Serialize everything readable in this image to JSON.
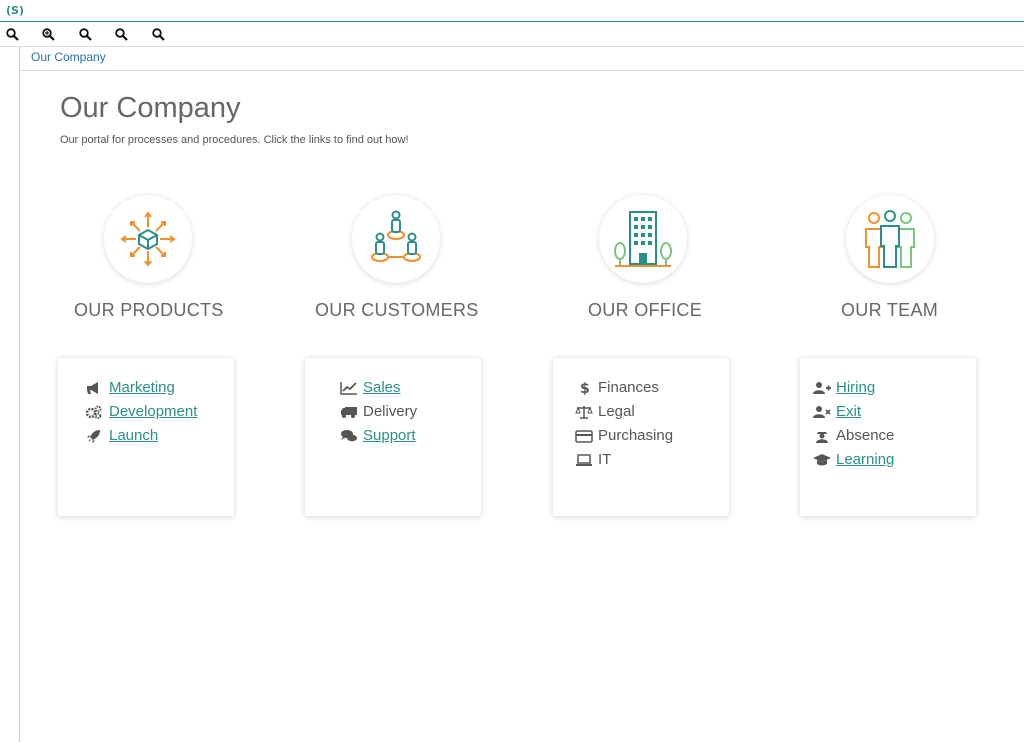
{
  "header": {
    "logo": "(S)"
  },
  "zoom": {
    "icons": [
      "zoom-out-icon",
      "zoom-in-icon",
      "zoom-fit-icon",
      "zoom-width-icon",
      "zoom-page-icon"
    ]
  },
  "breadcrumb": {
    "label": "Our Company"
  },
  "page": {
    "title": "Our Company",
    "subtitle": "Our portal for processes and procedures. Click the links to find out how!"
  },
  "sections": [
    {
      "title": "OUR PRODUCTS",
      "icon": "product-distribution-icon",
      "items": [
        {
          "label": "Marketing",
          "icon": "megaphone-icon",
          "link": true
        },
        {
          "label": "Development",
          "icon": "cogs-icon",
          "link": true
        },
        {
          "label": "Launch",
          "icon": "rocket-icon",
          "link": true
        }
      ]
    },
    {
      "title": "OUR CUSTOMERS",
      "icon": "customer-network-icon",
      "items": [
        {
          "label": "Sales",
          "icon": "line-chart-icon",
          "link": true
        },
        {
          "label": "Delivery",
          "icon": "truck-icon",
          "link": false
        },
        {
          "label": "Support",
          "icon": "comments-icon",
          "link": true
        }
      ]
    },
    {
      "title": "OUR OFFICE",
      "icon": "office-building-icon",
      "items": [
        {
          "label": "Finances",
          "icon": "dollar-icon",
          "link": false
        },
        {
          "label": "Legal",
          "icon": "balance-scale-icon",
          "link": false
        },
        {
          "label": "Purchasing",
          "icon": "credit-card-icon",
          "link": false
        },
        {
          "label": "IT",
          "icon": "laptop-icon",
          "link": false
        }
      ]
    },
    {
      "title": "OUR TEAM",
      "icon": "team-people-icon",
      "items": [
        {
          "label": "Hiring",
          "icon": "user-plus-icon",
          "link": true
        },
        {
          "label": "Exit",
          "icon": "user-times-icon",
          "link": true
        },
        {
          "label": "Absence",
          "icon": "user-secret-icon",
          "link": false
        },
        {
          "label": "Learning",
          "icon": "graduation-cap-icon",
          "link": true
        }
      ]
    }
  ],
  "colors": {
    "accent": "#2a8f8a",
    "orange": "#f0922b",
    "green": "#7cc47f"
  }
}
